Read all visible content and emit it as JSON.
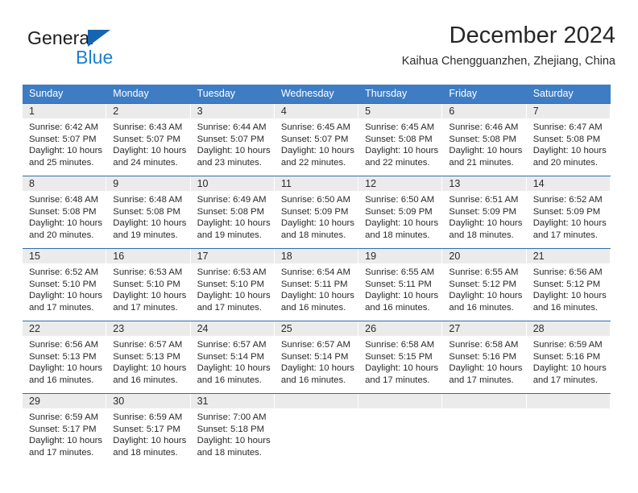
{
  "brand": {
    "name_top": "General",
    "name_bottom": "Blue",
    "accent_blue": "#1b7fd4",
    "triangle_blue": "#1565b0"
  },
  "header": {
    "title": "December 2024",
    "location": "Kaihua Chengguanzhen, Zhejiang, China"
  },
  "theme": {
    "header_row_bg": "#3e7dc4",
    "header_row_text": "#ffffff",
    "daynum_bg": "#ebebeb",
    "row_divider": "#2f6fae"
  },
  "weekdays": [
    "Sunday",
    "Monday",
    "Tuesday",
    "Wednesday",
    "Thursday",
    "Friday",
    "Saturday"
  ],
  "labels": {
    "sunrise_prefix": "Sunrise:",
    "sunset_prefix": "Sunset:",
    "daylight_prefix": "Daylight:"
  },
  "weeks": [
    [
      {
        "day": "1",
        "sunrise": "Sunrise: 6:42 AM",
        "sunset": "Sunset: 5:07 PM",
        "daylight1": "Daylight: 10 hours",
        "daylight2": "and 25 minutes."
      },
      {
        "day": "2",
        "sunrise": "Sunrise: 6:43 AM",
        "sunset": "Sunset: 5:07 PM",
        "daylight1": "Daylight: 10 hours",
        "daylight2": "and 24 minutes."
      },
      {
        "day": "3",
        "sunrise": "Sunrise: 6:44 AM",
        "sunset": "Sunset: 5:07 PM",
        "daylight1": "Daylight: 10 hours",
        "daylight2": "and 23 minutes."
      },
      {
        "day": "4",
        "sunrise": "Sunrise: 6:45 AM",
        "sunset": "Sunset: 5:07 PM",
        "daylight1": "Daylight: 10 hours",
        "daylight2": "and 22 minutes."
      },
      {
        "day": "5",
        "sunrise": "Sunrise: 6:45 AM",
        "sunset": "Sunset: 5:08 PM",
        "daylight1": "Daylight: 10 hours",
        "daylight2": "and 22 minutes."
      },
      {
        "day": "6",
        "sunrise": "Sunrise: 6:46 AM",
        "sunset": "Sunset: 5:08 PM",
        "daylight1": "Daylight: 10 hours",
        "daylight2": "and 21 minutes."
      },
      {
        "day": "7",
        "sunrise": "Sunrise: 6:47 AM",
        "sunset": "Sunset: 5:08 PM",
        "daylight1": "Daylight: 10 hours",
        "daylight2": "and 20 minutes."
      }
    ],
    [
      {
        "day": "8",
        "sunrise": "Sunrise: 6:48 AM",
        "sunset": "Sunset: 5:08 PM",
        "daylight1": "Daylight: 10 hours",
        "daylight2": "and 20 minutes."
      },
      {
        "day": "9",
        "sunrise": "Sunrise: 6:48 AM",
        "sunset": "Sunset: 5:08 PM",
        "daylight1": "Daylight: 10 hours",
        "daylight2": "and 19 minutes."
      },
      {
        "day": "10",
        "sunrise": "Sunrise: 6:49 AM",
        "sunset": "Sunset: 5:08 PM",
        "daylight1": "Daylight: 10 hours",
        "daylight2": "and 19 minutes."
      },
      {
        "day": "11",
        "sunrise": "Sunrise: 6:50 AM",
        "sunset": "Sunset: 5:09 PM",
        "daylight1": "Daylight: 10 hours",
        "daylight2": "and 18 minutes."
      },
      {
        "day": "12",
        "sunrise": "Sunrise: 6:50 AM",
        "sunset": "Sunset: 5:09 PM",
        "daylight1": "Daylight: 10 hours",
        "daylight2": "and 18 minutes."
      },
      {
        "day": "13",
        "sunrise": "Sunrise: 6:51 AM",
        "sunset": "Sunset: 5:09 PM",
        "daylight1": "Daylight: 10 hours",
        "daylight2": "and 18 minutes."
      },
      {
        "day": "14",
        "sunrise": "Sunrise: 6:52 AM",
        "sunset": "Sunset: 5:09 PM",
        "daylight1": "Daylight: 10 hours",
        "daylight2": "and 17 minutes."
      }
    ],
    [
      {
        "day": "15",
        "sunrise": "Sunrise: 6:52 AM",
        "sunset": "Sunset: 5:10 PM",
        "daylight1": "Daylight: 10 hours",
        "daylight2": "and 17 minutes."
      },
      {
        "day": "16",
        "sunrise": "Sunrise: 6:53 AM",
        "sunset": "Sunset: 5:10 PM",
        "daylight1": "Daylight: 10 hours",
        "daylight2": "and 17 minutes."
      },
      {
        "day": "17",
        "sunrise": "Sunrise: 6:53 AM",
        "sunset": "Sunset: 5:10 PM",
        "daylight1": "Daylight: 10 hours",
        "daylight2": "and 17 minutes."
      },
      {
        "day": "18",
        "sunrise": "Sunrise: 6:54 AM",
        "sunset": "Sunset: 5:11 PM",
        "daylight1": "Daylight: 10 hours",
        "daylight2": "and 16 minutes."
      },
      {
        "day": "19",
        "sunrise": "Sunrise: 6:55 AM",
        "sunset": "Sunset: 5:11 PM",
        "daylight1": "Daylight: 10 hours",
        "daylight2": "and 16 minutes."
      },
      {
        "day": "20",
        "sunrise": "Sunrise: 6:55 AM",
        "sunset": "Sunset: 5:12 PM",
        "daylight1": "Daylight: 10 hours",
        "daylight2": "and 16 minutes."
      },
      {
        "day": "21",
        "sunrise": "Sunrise: 6:56 AM",
        "sunset": "Sunset: 5:12 PM",
        "daylight1": "Daylight: 10 hours",
        "daylight2": "and 16 minutes."
      }
    ],
    [
      {
        "day": "22",
        "sunrise": "Sunrise: 6:56 AM",
        "sunset": "Sunset: 5:13 PM",
        "daylight1": "Daylight: 10 hours",
        "daylight2": "and 16 minutes."
      },
      {
        "day": "23",
        "sunrise": "Sunrise: 6:57 AM",
        "sunset": "Sunset: 5:13 PM",
        "daylight1": "Daylight: 10 hours",
        "daylight2": "and 16 minutes."
      },
      {
        "day": "24",
        "sunrise": "Sunrise: 6:57 AM",
        "sunset": "Sunset: 5:14 PM",
        "daylight1": "Daylight: 10 hours",
        "daylight2": "and 16 minutes."
      },
      {
        "day": "25",
        "sunrise": "Sunrise: 6:57 AM",
        "sunset": "Sunset: 5:14 PM",
        "daylight1": "Daylight: 10 hours",
        "daylight2": "and 16 minutes."
      },
      {
        "day": "26",
        "sunrise": "Sunrise: 6:58 AM",
        "sunset": "Sunset: 5:15 PM",
        "daylight1": "Daylight: 10 hours",
        "daylight2": "and 17 minutes."
      },
      {
        "day": "27",
        "sunrise": "Sunrise: 6:58 AM",
        "sunset": "Sunset: 5:16 PM",
        "daylight1": "Daylight: 10 hours",
        "daylight2": "and 17 minutes."
      },
      {
        "day": "28",
        "sunrise": "Sunrise: 6:59 AM",
        "sunset": "Sunset: 5:16 PM",
        "daylight1": "Daylight: 10 hours",
        "daylight2": "and 17 minutes."
      }
    ],
    [
      {
        "day": "29",
        "sunrise": "Sunrise: 6:59 AM",
        "sunset": "Sunset: 5:17 PM",
        "daylight1": "Daylight: 10 hours",
        "daylight2": "and 17 minutes."
      },
      {
        "day": "30",
        "sunrise": "Sunrise: 6:59 AM",
        "sunset": "Sunset: 5:17 PM",
        "daylight1": "Daylight: 10 hours",
        "daylight2": "and 18 minutes."
      },
      {
        "day": "31",
        "sunrise": "Sunrise: 7:00 AM",
        "sunset": "Sunset: 5:18 PM",
        "daylight1": "Daylight: 10 hours",
        "daylight2": "and 18 minutes."
      },
      {
        "day": "",
        "sunrise": "",
        "sunset": "",
        "daylight1": "",
        "daylight2": ""
      },
      {
        "day": "",
        "sunrise": "",
        "sunset": "",
        "daylight1": "",
        "daylight2": ""
      },
      {
        "day": "",
        "sunrise": "",
        "sunset": "",
        "daylight1": "",
        "daylight2": ""
      },
      {
        "day": "",
        "sunrise": "",
        "sunset": "",
        "daylight1": "",
        "daylight2": ""
      }
    ]
  ]
}
